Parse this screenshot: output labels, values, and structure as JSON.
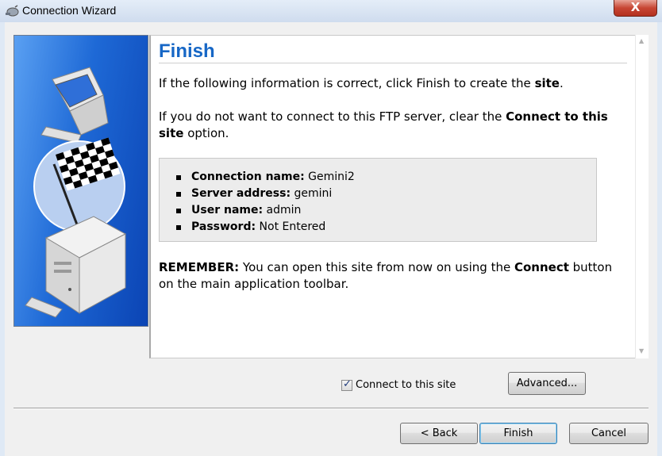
{
  "window": {
    "title": "Connection Wizard",
    "close_label": "X"
  },
  "main": {
    "heading": "Finish",
    "p1_before": "If the following information is correct, click Finish to create the ",
    "p1_bold": "site",
    "p1_after": ".",
    "p2_before": "If you do not want to connect to this FTP server, clear the ",
    "p2_bold": "Connect to this site",
    "p2_after": " option.",
    "summary": [
      {
        "label": "Connection name:",
        "value": " Gemini2"
      },
      {
        "label": "Server address:",
        "value": " gemini"
      },
      {
        "label": "User name:",
        "value": " admin"
      },
      {
        "label": "Password:",
        "value": " Not Entered"
      }
    ],
    "p3_bold1": "REMEMBER:",
    "p3_mid": " You can open this site from now on using the ",
    "p3_bold2": "Connect",
    "p3_after": " button on the main application toolbar."
  },
  "options": {
    "connect_label": "Connect to this site",
    "connect_checked": true,
    "check_mark": "✓",
    "advanced_label": "Advanced..."
  },
  "footer": {
    "back_label": "< Back",
    "finish_label": "Finish",
    "cancel_label": "Cancel"
  },
  "icons": {
    "app": "ftp-plug-icon",
    "side_art": "computers-checkered-flag-art",
    "scroll_up": "▲",
    "scroll_down": "▼"
  },
  "colors": {
    "heading": "#1767c6",
    "panel_blue": "#1e69d6",
    "close_red": "#c74634"
  }
}
